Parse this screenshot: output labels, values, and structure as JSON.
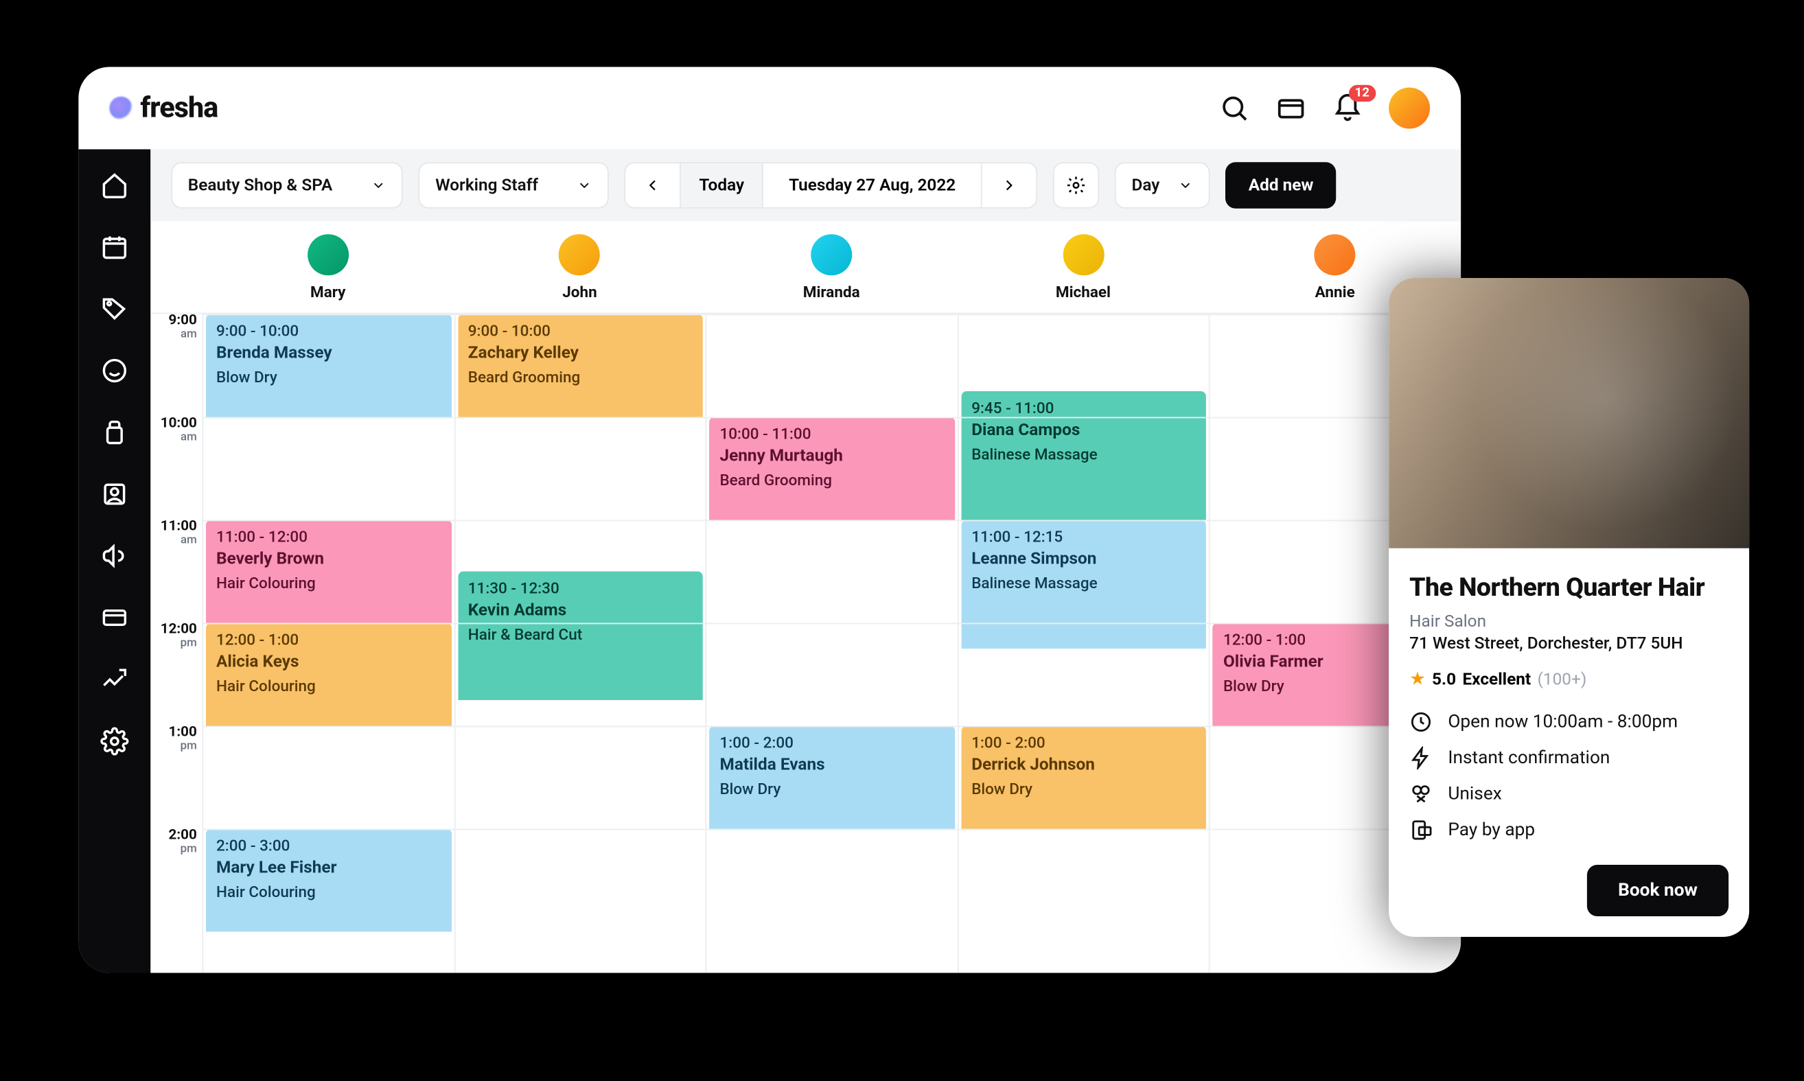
{
  "brand": "fresha",
  "notifications_badge": "12",
  "toolbar": {
    "location": "Beauty Shop & SPA",
    "staff_filter": "Working Staff",
    "today": "Today",
    "date": "Tuesday 27 Aug, 2022",
    "view": "Day",
    "add_new": "Add new"
  },
  "staff": [
    "Mary",
    "John",
    "Miranda",
    "Michael",
    "Annie"
  ],
  "hours": [
    {
      "h": "9:00",
      "ap": "am"
    },
    {
      "h": "10:00",
      "ap": "am"
    },
    {
      "h": "11:00",
      "ap": "am"
    },
    {
      "h": "12:00",
      "ap": "pm"
    },
    {
      "h": "1:00",
      "ap": "pm"
    },
    {
      "h": "2:00",
      "ap": "pm"
    }
  ],
  "appointments": [
    {
      "col": 0,
      "start": 9.0,
      "end": 10.0,
      "color": "blue",
      "time": "9:00 - 10:00",
      "client": "Brenda Massey",
      "svc": "Blow Dry"
    },
    {
      "col": 1,
      "start": 9.0,
      "end": 10.0,
      "color": "orange",
      "time": "9:00 - 10:00",
      "client": "Zachary Kelley",
      "svc": "Beard Grooming"
    },
    {
      "col": 2,
      "start": 10.0,
      "end": 11.0,
      "color": "pink",
      "time": "10:00 - 11:00",
      "client": "Jenny Murtaugh",
      "svc": "Beard Grooming"
    },
    {
      "col": 3,
      "start": 9.75,
      "end": 11.0,
      "color": "teal",
      "time": "9:45 - 11:00",
      "client": "Diana Campos",
      "svc": "Balinese Massage"
    },
    {
      "col": 0,
      "start": 11.0,
      "end": 12.0,
      "color": "pink",
      "time": "11:00 - 12:00",
      "client": "Beverly Brown",
      "svc": "Hair Colouring"
    },
    {
      "col": 1,
      "start": 11.5,
      "end": 12.75,
      "color": "teal",
      "time": "11:30 - 12:30",
      "client": "Kevin Adams",
      "svc": "Hair & Beard Cut"
    },
    {
      "col": 3,
      "start": 11.0,
      "end": 12.25,
      "color": "blue",
      "time": "11:00 - 12:15",
      "client": "Leanne Simpson",
      "svc": "Balinese Massage"
    },
    {
      "col": 0,
      "start": 12.0,
      "end": 13.0,
      "color": "orange",
      "time": "12:00 - 1:00",
      "client": "Alicia Keys",
      "svc": "Hair Colouring"
    },
    {
      "col": 4,
      "start": 12.0,
      "end": 13.0,
      "color": "pink",
      "time": "12:00 - 1:00",
      "client": "Olivia Farmer",
      "svc": "Blow Dry"
    },
    {
      "col": 2,
      "start": 13.0,
      "end": 14.0,
      "color": "blue",
      "time": "1:00 - 2:00",
      "client": "Matilda Evans",
      "svc": "Blow Dry"
    },
    {
      "col": 3,
      "start": 13.0,
      "end": 14.0,
      "color": "orange",
      "time": "1:00 - 2:00",
      "client": "Derrick Johnson",
      "svc": "Blow Dry"
    },
    {
      "col": 0,
      "start": 14.0,
      "end": 15.0,
      "color": "blue",
      "time": "2:00 - 3:00",
      "client": "Mary Lee Fisher",
      "svc": "Hair Colouring"
    }
  ],
  "card": {
    "title": "The Northern Quarter Hair",
    "category": "Hair Salon",
    "address": "71 West Street, Dorchester, DT7 5UH",
    "rating_num": "5.0",
    "rating_text": "Excellent",
    "rating_count": "(100+)",
    "features": [
      "Open now 10:00am - 8:00pm",
      "Instant confirmation",
      "Unisex",
      "Pay by app"
    ],
    "cta": "Book now"
  }
}
